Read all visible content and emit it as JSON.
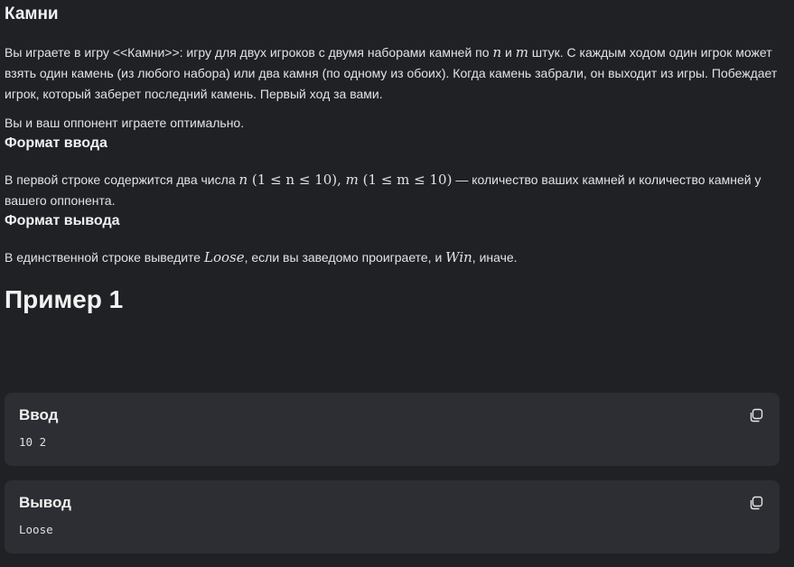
{
  "problem": {
    "title": "Камни",
    "statement": {
      "part1": "Вы играете в игру <<Камни>>: игру для двух игроков с двумя наборами камней по ",
      "var_n": "n",
      "and": " и ",
      "var_m": "m",
      "part2": " штук. С каждым ходом один игрок может взять один камень (из любого набора) или два камня (по одному из обоих). Когда камень забрали, он выходит из игры. Побеждает игрок, который заберет последний камень. Первый ход за вами."
    },
    "optimal_note": "Вы и ваш оппонент играете оптимально."
  },
  "input_format": {
    "heading": "Формат ввода",
    "text_before": "В первой строке содержится два числа ",
    "n_var": "n",
    "n_constraint": " (1 ≤ n ≤ 10), ",
    "m_var": "m",
    "m_constraint": " (1 ≤ m ≤ 10)",
    "text_after": " — количество ваших камней и количество камней у вашего оппонента."
  },
  "output_format": {
    "heading": "Формат вывода",
    "text_before": "В единственной строке выведите ",
    "lose_word": "Loose",
    "text_middle": ", если вы заведомо проиграете, и ",
    "win_word": "Win",
    "text_after": ", иначе."
  },
  "example": {
    "heading": "Пример 1",
    "input_label": "Ввод",
    "input_value": "10 2",
    "output_label": "Вывод",
    "output_value": "Loose",
    "copy_icon": "copy-icon"
  }
}
